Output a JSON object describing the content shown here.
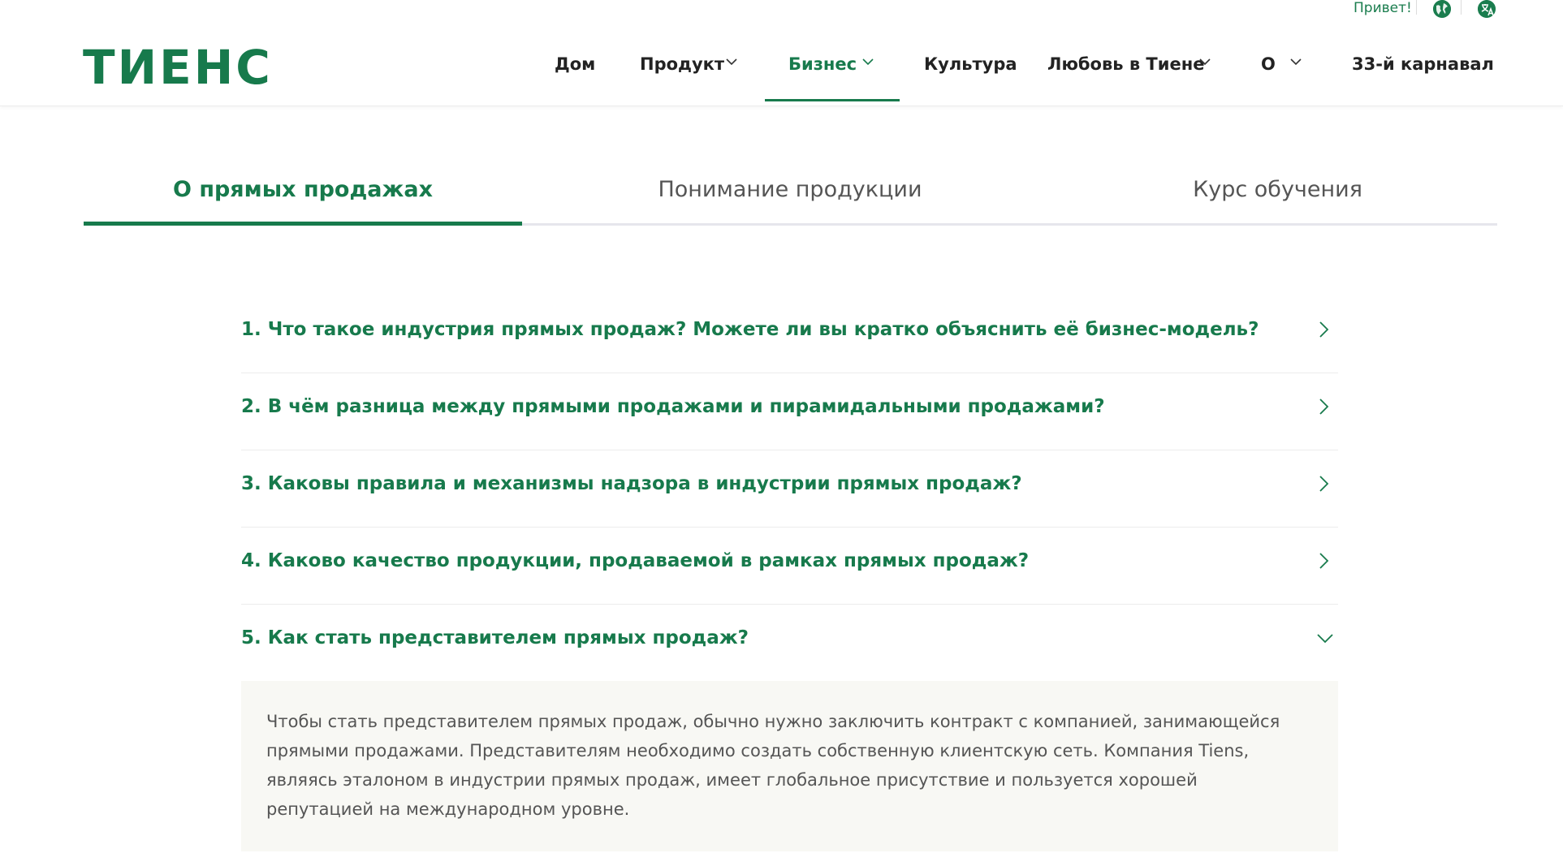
{
  "topbar": {
    "greeting": "Привет!",
    "icons": [
      "globe-icon",
      "translate-icon"
    ]
  },
  "header": {
    "logo": "ТИЕНС",
    "nav": [
      {
        "label": "Дом",
        "has_dropdown": false,
        "active": false
      },
      {
        "label": "Продукт",
        "has_dropdown": true,
        "active": false
      },
      {
        "label": "Бизнес",
        "has_dropdown": true,
        "active": true
      },
      {
        "label": "Культура",
        "has_dropdown": false,
        "active": false
      },
      {
        "label": "Любовь в Тиене",
        "has_dropdown": true,
        "active": false
      },
      {
        "label": "О",
        "has_dropdown": true,
        "active": false
      },
      {
        "label": "33-й карнавал",
        "has_dropdown": false,
        "active": false
      }
    ]
  },
  "tabs": [
    {
      "label": "О прямых продажах",
      "active": true
    },
    {
      "label": "Понимание продукции",
      "active": false
    },
    {
      "label": "Курс обучения",
      "active": false
    }
  ],
  "faq": [
    {
      "question": "1. Что такое индустрия прямых продаж? Можете ли вы кратко объяснить её бизнес-модель?",
      "expanded": false
    },
    {
      "question": "2. В чём разница между прямыми продажами и пирамидальными продажами?",
      "expanded": false
    },
    {
      "question": "3. Каковы правила и механизмы надзора в индустрии прямых продаж?",
      "expanded": false
    },
    {
      "question": "4. Каково качество продукции, продаваемой в рамках прямых продаж?",
      "expanded": false
    },
    {
      "question": "5. Как стать представителем прямых продаж?",
      "expanded": true,
      "answer": "Чтобы стать представителем прямых продаж, обычно нужно заключить контракт с компанией, занимающейся прямыми продажами. Представителям необходимо создать собственную клиентскую сеть. Компания Tiens, являясь эталоном в индустрии прямых продаж, имеет глобальное присутствие и пользуется хорошей репутацией на международном уровне."
    }
  ],
  "colors": {
    "brand_green": "#177a4c",
    "answer_bg": "#f8f8f4",
    "text": "#222222",
    "muted_text": "#555555"
  }
}
